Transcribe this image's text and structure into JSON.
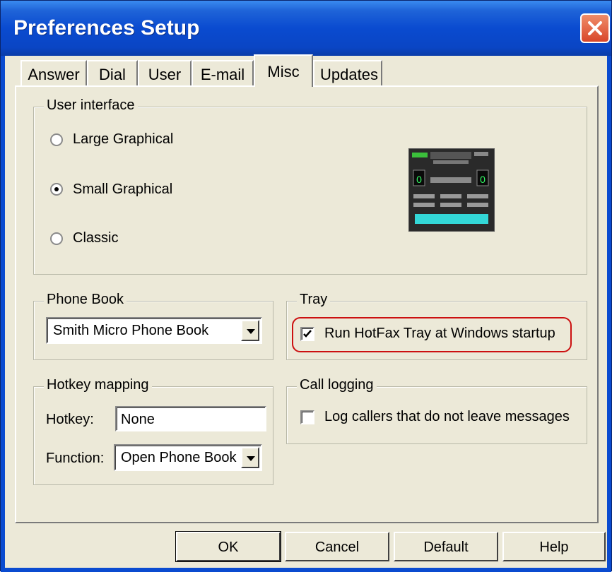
{
  "window": {
    "title": "Preferences Setup"
  },
  "tabs": [
    {
      "label": "Answer"
    },
    {
      "label": "Dial"
    },
    {
      "label": "User"
    },
    {
      "label": "E-mail"
    },
    {
      "label": "Misc"
    },
    {
      "label": "Updates"
    }
  ],
  "active_tab": "Misc",
  "user_interface": {
    "label": "User interface",
    "options": [
      {
        "label": "Large Graphical",
        "selected": false
      },
      {
        "label": "Small Graphical",
        "selected": true
      },
      {
        "label": "Classic",
        "selected": false
      }
    ]
  },
  "phone_book": {
    "label": "Phone Book",
    "value": "Smith Micro Phone Book"
  },
  "tray": {
    "label": "Tray",
    "checkbox_label": "Run HotFax Tray at Windows startup",
    "checked": true
  },
  "hotkey_mapping": {
    "label": "Hotkey mapping",
    "hotkey_label": "Hotkey:",
    "hotkey_value": "None",
    "function_label": "Function:",
    "function_value": "Open Phone Book"
  },
  "call_logging": {
    "label": "Call logging",
    "checkbox_label": "Log callers that do not leave messages",
    "checked": false
  },
  "buttons": {
    "ok": "OK",
    "cancel": "Cancel",
    "default": "Default",
    "help": "Help"
  },
  "colors": {
    "title_bar": "#0a4bd0",
    "dialog_bg": "#ece9d8",
    "highlight": "#cc1010",
    "close_button": "#d8462a"
  }
}
